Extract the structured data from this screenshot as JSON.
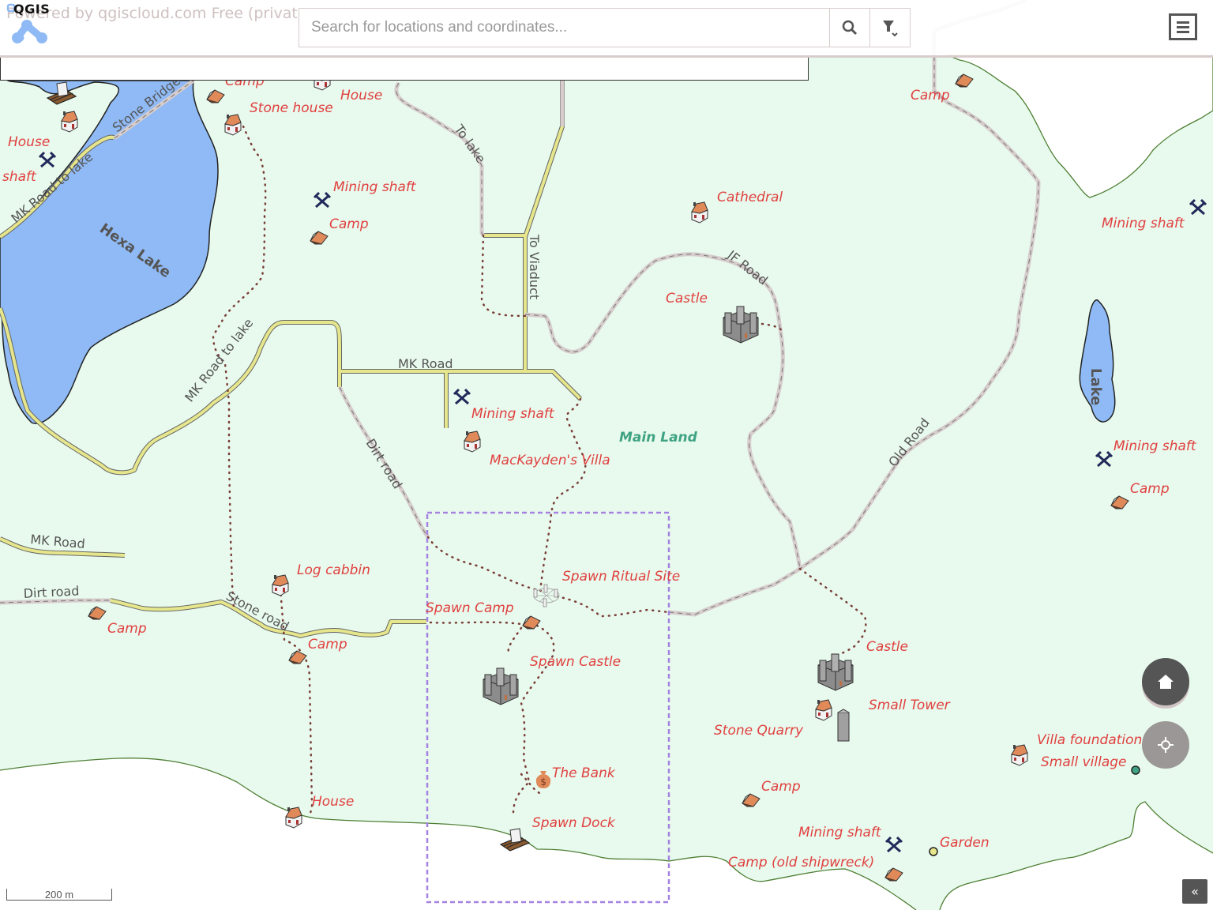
{
  "header": {
    "logo_text": "QGIS",
    "powered_by": "Powered by qgiscloud.com Free (private",
    "search_placeholder": "Search for locations and coordinates...",
    "search_value": "",
    "search_button_icon": "search-icon",
    "filter_button_icon": "filter-icon",
    "menu_button_icon": "hamburger-menu-icon"
  },
  "controls": {
    "home_icon": "home-icon",
    "locate_icon": "crosshair-icon",
    "collapse_label": "«",
    "scale_label": "200 m"
  },
  "colors": {
    "land": "#e8faed",
    "water": "#8fbaf5",
    "coast": "#4f7f35",
    "label": "#e04040",
    "major_road": "#e6e68c",
    "dirt_road": "#d6cccc",
    "trail": "#7a3e38",
    "spawn_area": "#a483e0",
    "region_label": "#3fa383"
  },
  "map": {
    "region_label": "Main Land",
    "lakes": [
      "Hexa Lake",
      "Lake"
    ],
    "roads": [
      "Stone Bridge",
      "MK Road to lake",
      "MK Road to lake",
      "To lake",
      "To Viaduct",
      "JF Road",
      "MK Road",
      "Dirt road",
      "Old Road",
      "MK Road",
      "Dirt road",
      "Stone road"
    ],
    "places": [
      {
        "name": "Camp",
        "type": "camp"
      },
      {
        "name": "House",
        "type": "house"
      },
      {
        "name": "Stone house",
        "type": "house"
      },
      {
        "name": "House",
        "type": "house"
      },
      {
        "name": "shaft",
        "type": "mine"
      },
      {
        "name": "Mining shaft",
        "type": "mine"
      },
      {
        "name": "Camp",
        "type": "camp"
      },
      {
        "name": "Cathedral",
        "type": "house"
      },
      {
        "name": "Castle",
        "type": "castle"
      },
      {
        "name": "Camp",
        "type": "camp"
      },
      {
        "name": "Mining shaft",
        "type": "mine"
      },
      {
        "name": "Mining shaft",
        "type": "mine"
      },
      {
        "name": "MacKayden's Villa",
        "type": "house"
      },
      {
        "name": "Mining shaft",
        "type": "mine"
      },
      {
        "name": "Camp",
        "type": "camp"
      },
      {
        "name": "Log cabbin",
        "type": "house"
      },
      {
        "name": "Spawn Ritual Site",
        "type": "ritual"
      },
      {
        "name": "Spawn Camp",
        "type": "camp"
      },
      {
        "name": "Camp",
        "type": "camp"
      },
      {
        "name": "Camp",
        "type": "camp"
      },
      {
        "name": "Spawn Castle",
        "type": "castle"
      },
      {
        "name": "Castle",
        "type": "castle"
      },
      {
        "name": "Small Tower",
        "type": "tower"
      },
      {
        "name": "Stone Quarry",
        "type": "house"
      },
      {
        "name": "Villa foundation",
        "type": "house"
      },
      {
        "name": "Small village",
        "type": "dot-green"
      },
      {
        "name": "The Bank",
        "type": "bank"
      },
      {
        "name": "House",
        "type": "house"
      },
      {
        "name": "Spawn Dock",
        "type": "dock"
      },
      {
        "name": "Camp",
        "type": "camp"
      },
      {
        "name": "Mining shaft",
        "type": "mine"
      },
      {
        "name": "Garden",
        "type": "dot-yellow"
      },
      {
        "name": "Camp (old shipwreck)",
        "type": "camp"
      }
    ]
  }
}
